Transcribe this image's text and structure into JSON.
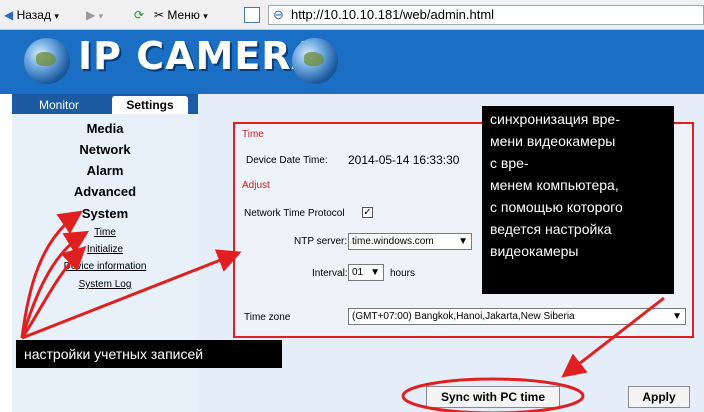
{
  "toolbar": {
    "back_label": "Назад",
    "menu_label": "Меню",
    "url": "http://10.10.10.181/web/admin.html"
  },
  "banner": {
    "title": "IP CAMERA"
  },
  "tabs": {
    "monitor": "Monitor",
    "settings": "Settings"
  },
  "nav": {
    "media": "Media",
    "network": "Network",
    "alarm": "Alarm",
    "advanced": "Advanced",
    "system": "System",
    "time": "Time",
    "initialize": "Initialize",
    "device_information": "Device information",
    "system_log": "System Log"
  },
  "panel": {
    "time_heading": "Time",
    "device_date_time_label": "Device Date Time:",
    "device_date_time_value": "2014-05-14 16:33:30",
    "adjust_heading": "Adjust",
    "ntp_label": "Network Time Protocol",
    "ntp_checked": "✓",
    "ntp_server_label": "NTP server:",
    "ntp_server_value": "time.windows.com",
    "interval_label": "Interval:",
    "interval_value": "01",
    "interval_unit": "hours",
    "timezone_label": "Time zone",
    "timezone_value": "(GMT+07:00) Bangkok,Hanoi,Jakarta,New Siberia"
  },
  "buttons": {
    "sync": "Sync with PC time",
    "apply": "Apply"
  },
  "annotations": {
    "sync_note_lines": [
      "синхронизация вре-",
      "мени видеокамеры",
      "с вре-",
      "менем компьютера,",
      "с помощью которого",
      "ведется настройка",
      "видеокамеры"
    ],
    "accounts_note": "настройки учетных записей"
  },
  "colors": {
    "banner": "#1a6fc4",
    "accent_red": "#e02020",
    "tab_bar": "#1d5aa0"
  }
}
